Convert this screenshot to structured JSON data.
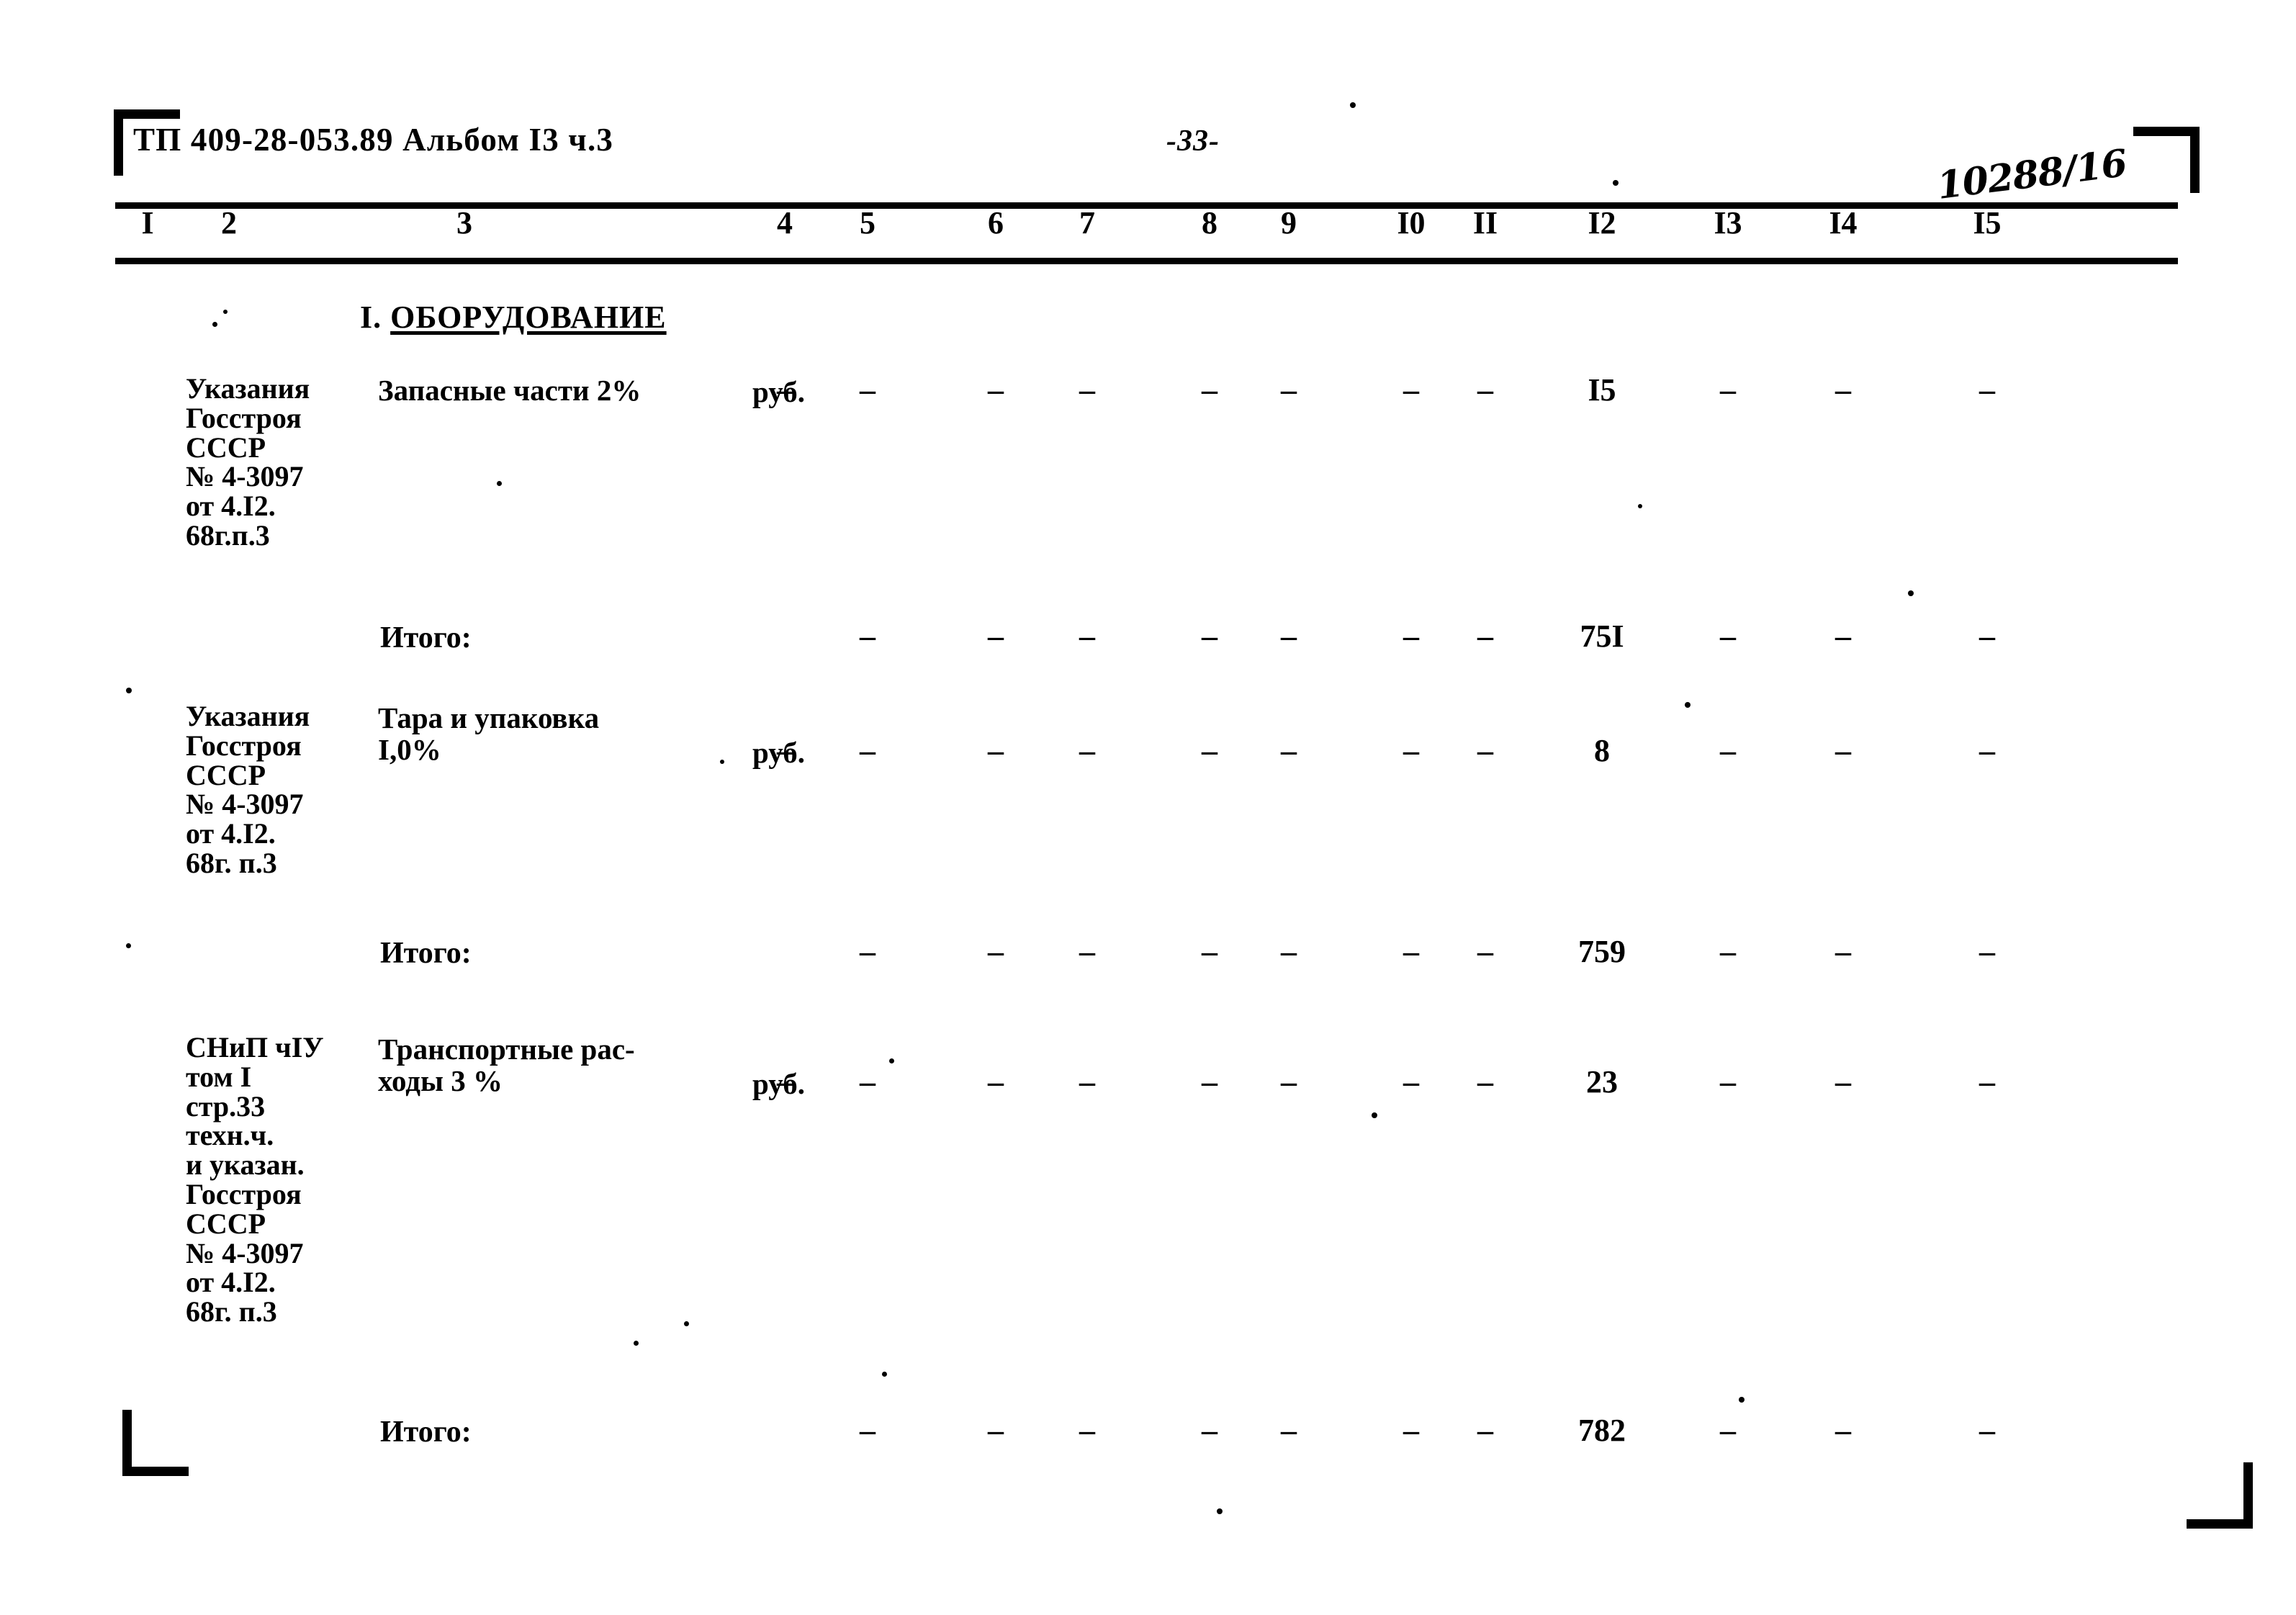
{
  "document": {
    "code": "ТП 409-28-053.89 Альбом I3 ч.3",
    "page_number": "-33-",
    "handwritten_note": "10288/16"
  },
  "table": {
    "column_numbers": [
      "I",
      "2",
      "3",
      "4",
      "5",
      "6",
      "7",
      "8",
      "9",
      "I0",
      "II",
      "I2",
      "I3",
      "I4",
      "I5"
    ],
    "section_heading": {
      "number": "I.",
      "title": "ОБОРУДОВАНИЕ"
    },
    "rows": [
      {
        "kind": "item",
        "reference": "Указания\nГосстроя\nСССР\n№ 4-3097\nот 4.I2.\n68г.п.3",
        "description": "Запасные части 2%",
        "unit": "руб.",
        "dashes": [
          "4",
          "5",
          "6",
          "7",
          "8",
          "9",
          "I0",
          "II",
          "I3",
          "I4",
          "I5"
        ],
        "value_column": "I2",
        "value": "I5"
      },
      {
        "kind": "total",
        "label": "Итого:",
        "dashes": [
          "5",
          "6",
          "7",
          "8",
          "9",
          "I0",
          "II",
          "I3",
          "I4",
          "I5"
        ],
        "value_column": "I2",
        "value": "75I"
      },
      {
        "kind": "item",
        "reference": "Указания\nГосстроя\nСССР\n№ 4-3097\nот 4.I2.\n68г. п.3",
        "description": "Тара и упаковка\nI,0%",
        "unit": "руб.",
        "dashes": [
          "4",
          "5",
          "6",
          "7",
          "8",
          "9",
          "I0",
          "II",
          "I3",
          "I4",
          "I5"
        ],
        "value_column": "I2",
        "value": "8"
      },
      {
        "kind": "total",
        "label": "Итого:",
        "dashes": [
          "5",
          "6",
          "7",
          "8",
          "9",
          "I0",
          "II",
          "I3",
          "I4",
          "I5"
        ],
        "value_column": "I2",
        "value": "759"
      },
      {
        "kind": "item",
        "reference": "СНиП чIУ\nтом I\nстр.33\nтехн.ч.\nи указан.\nГосстроя\nСССР\n№ 4-3097\nот 4.I2.\n68г. п.3",
        "description": "Транспортные рас-\nходы 3 %",
        "unit": "руб.",
        "dashes": [
          "4",
          "5",
          "6",
          "7",
          "8",
          "9",
          "I0",
          "II",
          "I3",
          "I4",
          "I5"
        ],
        "value_column": "I2",
        "value": "23"
      },
      {
        "kind": "total",
        "label": "Итого:",
        "dashes": [
          "5",
          "6",
          "7",
          "8",
          "9",
          "I0",
          "II",
          "I3",
          "I4",
          "I5"
        ],
        "value_column": "I2",
        "value": "782"
      }
    ]
  },
  "layout": {
    "column_x": {
      "I": 205,
      "2": 318,
      "3": 645,
      "4": 1090,
      "5": 1205,
      "6": 1383,
      "7": 1510,
      "8": 1680,
      "9": 1790,
      "I0": 1960,
      "II": 2063,
      "I2": 2225,
      "I3": 2400,
      "I4": 2560,
      "I5": 2760
    },
    "row_y": {
      "row1": 520,
      "total1": 862,
      "row2": 975,
      "total2": 1300,
      "row3": 1435,
      "total3": 1965
    }
  }
}
